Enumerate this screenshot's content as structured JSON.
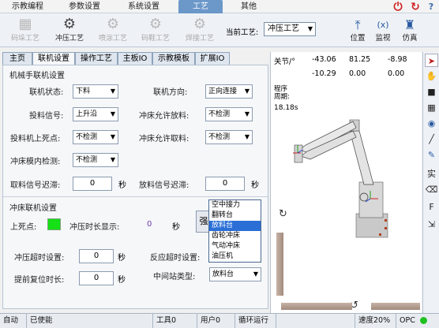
{
  "top_menu": {
    "items": [
      "示教编程",
      "参数设置",
      "系统设置",
      "工艺",
      "其他"
    ],
    "active": "工艺"
  },
  "ribbon": {
    "tools": [
      {
        "label": "码垛工艺",
        "icon": "palletizing-icon",
        "active": false
      },
      {
        "label": "冲压工艺",
        "icon": "stamping-icon",
        "active": true
      },
      {
        "label": "喷涂工艺",
        "icon": "spraying-icon",
        "active": false
      },
      {
        "label": "码鞋工艺",
        "icon": "shoe-icon",
        "active": false
      },
      {
        "label": "焊接工艺",
        "icon": "welding-icon",
        "active": false
      }
    ],
    "current_process_label": "当前工艺:",
    "current_process_value": "冲压工艺",
    "right_tools": [
      {
        "label": "位置",
        "icon": "position-icon"
      },
      {
        "label": "监视",
        "icon": "monitor-icon"
      },
      {
        "label": "仿真",
        "icon": "simulation-icon"
      }
    ]
  },
  "tabs": [
    "主页",
    "联机设置",
    "操作工艺",
    "主板IO",
    "示教模板",
    "扩展IO"
  ],
  "active_tab": "联机设置",
  "robot_section": {
    "title": "机械手联机设置",
    "online_status_label": "联机状态:",
    "online_status_value": "下料",
    "online_dir_label": "联机方向:",
    "online_dir_value": "正向连接",
    "feed_signal_label": "投料信号:",
    "feed_signal_value": "上升沿",
    "press_allow_feed_label": "冲床允许放料:",
    "press_allow_feed_value": "不检测",
    "feed_top_dead_label": "投料机上死点:",
    "feed_top_dead_value": "不检测",
    "press_allow_take_label": "冲床允许取料:",
    "press_allow_take_value": "不检测",
    "press_cross_label": "冲床模内检测:",
    "press_cross_value": "不检测",
    "take_delay_label": "取料信号迟滞:",
    "take_delay_value": "0",
    "place_delay_label": "放料信号迟滞:",
    "place_delay_value": "0",
    "unit_sec": "秒"
  },
  "press_section": {
    "title": "冲床联机设置",
    "top_dead_label": "上死点:",
    "press_time_label": "冲压时长显示:",
    "press_time_value": "0",
    "press_time_unit": "秒",
    "confirm_label": "强",
    "press_timeout_label": "冲压超时设置:",
    "press_timeout_value": "0",
    "react_timeout_label": "反应超时设置:",
    "early_reset_label": "提前复位时长:",
    "early_reset_value": "0",
    "mid_station_label": "中间站类型:",
    "mid_station_value": "放料台",
    "unit_sec": "秒",
    "dropdown_options": [
      "空中接力",
      "翻转台",
      "放料台",
      "齿轮冲床",
      "气动冲床",
      "油压机"
    ],
    "dropdown_selected": "放料台"
  },
  "view": {
    "joint_label": "关节/°",
    "row1": [
      "-43.06",
      "81.25",
      "-8.98"
    ],
    "row2": [
      "-10.29",
      "0.00",
      "0.00"
    ],
    "cycle_label_1": "程序",
    "cycle_label_2": "周期:",
    "cycle_value": "18.18s"
  },
  "right_toolbar": [
    "cursor-icon",
    "hand-icon",
    "cube-icon",
    "grid-cube-icon",
    "eye-icon",
    "line-icon",
    "pen-icon",
    "solid-icon",
    "eraser-icon",
    "text-f-icon",
    "export-icon"
  ],
  "right_toolbar_text": {
    "solid": "实",
    "text_f": "F"
  },
  "status": {
    "mode": "自动",
    "enable": "已使能",
    "tool": "工具0",
    "user": "用户0",
    "loop": "循环运行",
    "speed": "速度20%",
    "opc": "OPC"
  }
}
